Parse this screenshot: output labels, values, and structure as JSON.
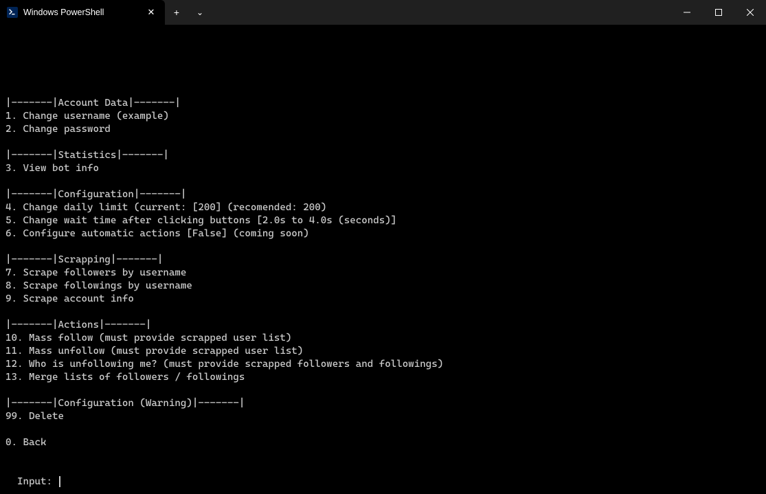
{
  "window": {
    "tab_title": "Windows PowerShell",
    "new_tab_glyph": "+",
    "dropdown_glyph": "⌄",
    "close_glyph": "✕"
  },
  "menu": {
    "sections": [
      {
        "header": "|-------|Account Data|-------|",
        "items": [
          "1. Change username (example)",
          "2. Change password"
        ]
      },
      {
        "header": "|-------|Statistics|-------|",
        "items": [
          "3. View bot info"
        ]
      },
      {
        "header": "|-------|Configuration|-------|",
        "items": [
          "4. Change daily limit (current: [200] (recomended: 200)",
          "5. Change wait time after clicking buttons [2.0s to 4.0s (seconds)]",
          "6. Configure automatic actions [False] (coming soon)"
        ]
      },
      {
        "header": "|-------|Scrapping|-------|",
        "items": [
          "7. Scrape followers by username",
          "8. Scrape followings by username",
          "9. Scrape account info"
        ]
      },
      {
        "header": "|-------|Actions|-------|",
        "items": [
          "10. Mass follow (must provide scrapped user list)",
          "11. Mass unfollow (must provide scrapped user list)",
          "12. Who is unfollowing me? (must provide scrapped followers and followings)",
          "13. Merge lists of followers / followings"
        ]
      },
      {
        "header": "|-------|Configuration (Warning)|-------|",
        "items": [
          "99. Delete"
        ]
      }
    ],
    "footer": [
      "0. Back"
    ],
    "prompt": "Input: "
  }
}
